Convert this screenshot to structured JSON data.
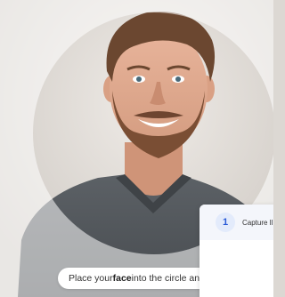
{
  "hint": {
    "prefix": "Place your ",
    "emphasis": "face",
    "suffix": " into the circle and cli"
  },
  "step": {
    "number": "1",
    "label": "Capture ll"
  },
  "colors": {
    "accent": "#2a5bd7",
    "step_badge_bg": "#e3ebfb",
    "card_header_bg": "#f4f6fb"
  },
  "icons": {
    "face_guide": "circle-outline"
  }
}
